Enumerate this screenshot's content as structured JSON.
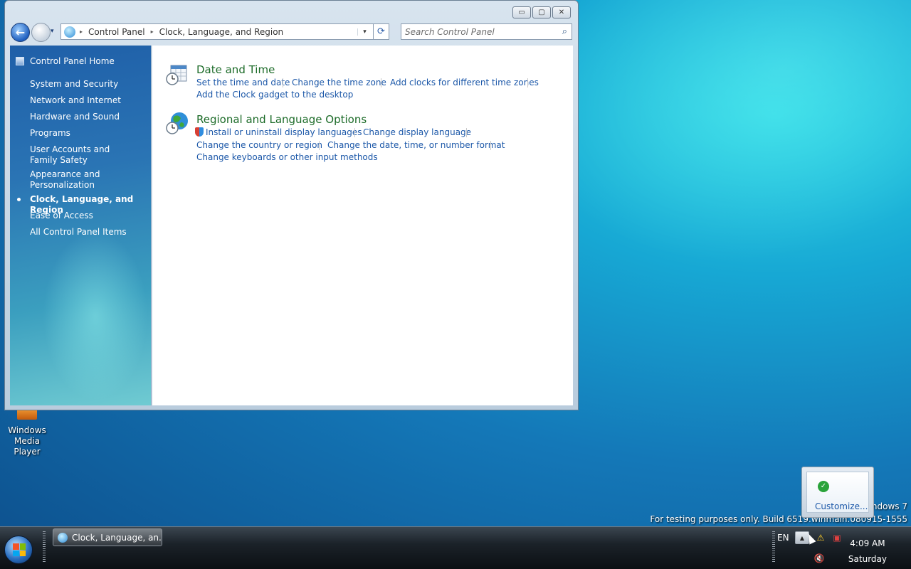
{
  "window": {
    "controls": {
      "minimize": "▭",
      "maximize": "▢",
      "close": "✕"
    },
    "address_bar": {
      "crumbs": [
        "Control Panel",
        "Clock, Language, and Region"
      ],
      "separator": "▸",
      "dropdown": "▾"
    },
    "refresh_icon": "⟳",
    "search": {
      "placeholder": "Search Control Panel",
      "icon": "⌕"
    }
  },
  "sidebar": {
    "home_label": "Control Panel Home",
    "items": [
      {
        "label": "System and Security",
        "active": false
      },
      {
        "label": "Network and Internet",
        "active": false
      },
      {
        "label": "Hardware and Sound",
        "active": false
      },
      {
        "label": "Programs",
        "active": false
      },
      {
        "label": "User Accounts and Family Safety",
        "active": false
      },
      {
        "label": "Appearance and Personalization",
        "active": false
      },
      {
        "label": "Clock, Language, and Region",
        "active": true
      },
      {
        "label": "Ease of Access",
        "active": false
      },
      {
        "label": "All Control Panel Items",
        "active": false
      }
    ]
  },
  "content": {
    "categories": [
      {
        "title": "Date and Time",
        "icon": "calendar-clock-icon",
        "links": [
          "Set the time and date",
          "Change the time zone",
          "Add clocks for different time zones",
          "Add the Clock gadget to the desktop"
        ]
      },
      {
        "title": "Regional and Language Options",
        "icon": "globe-clock-icon",
        "links": [
          "Install or uninstall display languages",
          "Change display language",
          "Change the country or region",
          "Change the date, time, or number format",
          "Change keyboards or other input methods"
        ]
      }
    ]
  },
  "desktop": {
    "icon_label": "Windows Media Player",
    "watermark_line1": "ndows 7",
    "watermark_line2": "For testing purposes only. Build 6519.winmain.080915-1555"
  },
  "taskbar": {
    "task_button": "Clock, Language, an...",
    "language": "EN",
    "time": "4:09 AM",
    "day": "Saturday",
    "tray_popup_action": "Customize..."
  },
  "colors": {
    "link": "#1b57a8",
    "category_title": "#1c6b28",
    "sidebar_top": "#1f5fa8",
    "sidebar_bottom": "#70cbd2"
  }
}
